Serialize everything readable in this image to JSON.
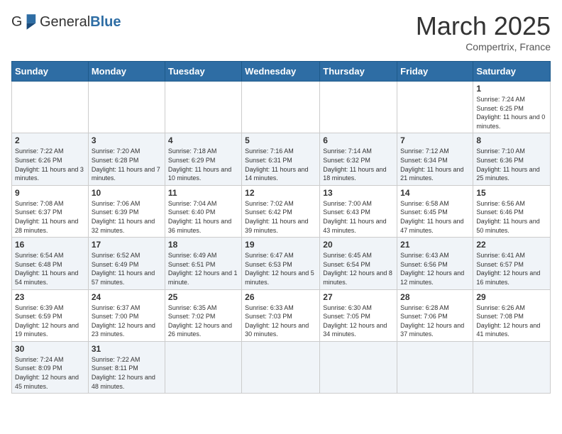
{
  "header": {
    "logo_general": "General",
    "logo_blue": "Blue",
    "month_title": "March 2025",
    "subtitle": "Compertrix, France"
  },
  "days_of_week": [
    "Sunday",
    "Monday",
    "Tuesday",
    "Wednesday",
    "Thursday",
    "Friday",
    "Saturday"
  ],
  "weeks": [
    [
      {
        "day": "",
        "info": ""
      },
      {
        "day": "",
        "info": ""
      },
      {
        "day": "",
        "info": ""
      },
      {
        "day": "",
        "info": ""
      },
      {
        "day": "",
        "info": ""
      },
      {
        "day": "",
        "info": ""
      },
      {
        "day": "1",
        "info": "Sunrise: 7:24 AM\nSunset: 6:25 PM\nDaylight: 11 hours and 0 minutes."
      }
    ],
    [
      {
        "day": "2",
        "info": "Sunrise: 7:22 AM\nSunset: 6:26 PM\nDaylight: 11 hours and 3 minutes."
      },
      {
        "day": "3",
        "info": "Sunrise: 7:20 AM\nSunset: 6:28 PM\nDaylight: 11 hours and 7 minutes."
      },
      {
        "day": "4",
        "info": "Sunrise: 7:18 AM\nSunset: 6:29 PM\nDaylight: 11 hours and 10 minutes."
      },
      {
        "day": "5",
        "info": "Sunrise: 7:16 AM\nSunset: 6:31 PM\nDaylight: 11 hours and 14 minutes."
      },
      {
        "day": "6",
        "info": "Sunrise: 7:14 AM\nSunset: 6:32 PM\nDaylight: 11 hours and 18 minutes."
      },
      {
        "day": "7",
        "info": "Sunrise: 7:12 AM\nSunset: 6:34 PM\nDaylight: 11 hours and 21 minutes."
      },
      {
        "day": "8",
        "info": "Sunrise: 7:10 AM\nSunset: 6:36 PM\nDaylight: 11 hours and 25 minutes."
      }
    ],
    [
      {
        "day": "9",
        "info": "Sunrise: 7:08 AM\nSunset: 6:37 PM\nDaylight: 11 hours and 28 minutes."
      },
      {
        "day": "10",
        "info": "Sunrise: 7:06 AM\nSunset: 6:39 PM\nDaylight: 11 hours and 32 minutes."
      },
      {
        "day": "11",
        "info": "Sunrise: 7:04 AM\nSunset: 6:40 PM\nDaylight: 11 hours and 36 minutes."
      },
      {
        "day": "12",
        "info": "Sunrise: 7:02 AM\nSunset: 6:42 PM\nDaylight: 11 hours and 39 minutes."
      },
      {
        "day": "13",
        "info": "Sunrise: 7:00 AM\nSunset: 6:43 PM\nDaylight: 11 hours and 43 minutes."
      },
      {
        "day": "14",
        "info": "Sunrise: 6:58 AM\nSunset: 6:45 PM\nDaylight: 11 hours and 47 minutes."
      },
      {
        "day": "15",
        "info": "Sunrise: 6:56 AM\nSunset: 6:46 PM\nDaylight: 11 hours and 50 minutes."
      }
    ],
    [
      {
        "day": "16",
        "info": "Sunrise: 6:54 AM\nSunset: 6:48 PM\nDaylight: 11 hours and 54 minutes."
      },
      {
        "day": "17",
        "info": "Sunrise: 6:52 AM\nSunset: 6:49 PM\nDaylight: 11 hours and 57 minutes."
      },
      {
        "day": "18",
        "info": "Sunrise: 6:49 AM\nSunset: 6:51 PM\nDaylight: 12 hours and 1 minute."
      },
      {
        "day": "19",
        "info": "Sunrise: 6:47 AM\nSunset: 6:53 PM\nDaylight: 12 hours and 5 minutes."
      },
      {
        "day": "20",
        "info": "Sunrise: 6:45 AM\nSunset: 6:54 PM\nDaylight: 12 hours and 8 minutes."
      },
      {
        "day": "21",
        "info": "Sunrise: 6:43 AM\nSunset: 6:56 PM\nDaylight: 12 hours and 12 minutes."
      },
      {
        "day": "22",
        "info": "Sunrise: 6:41 AM\nSunset: 6:57 PM\nDaylight: 12 hours and 16 minutes."
      }
    ],
    [
      {
        "day": "23",
        "info": "Sunrise: 6:39 AM\nSunset: 6:59 PM\nDaylight: 12 hours and 19 minutes."
      },
      {
        "day": "24",
        "info": "Sunrise: 6:37 AM\nSunset: 7:00 PM\nDaylight: 12 hours and 23 minutes."
      },
      {
        "day": "25",
        "info": "Sunrise: 6:35 AM\nSunset: 7:02 PM\nDaylight: 12 hours and 26 minutes."
      },
      {
        "day": "26",
        "info": "Sunrise: 6:33 AM\nSunset: 7:03 PM\nDaylight: 12 hours and 30 minutes."
      },
      {
        "day": "27",
        "info": "Sunrise: 6:30 AM\nSunset: 7:05 PM\nDaylight: 12 hours and 34 minutes."
      },
      {
        "day": "28",
        "info": "Sunrise: 6:28 AM\nSunset: 7:06 PM\nDaylight: 12 hours and 37 minutes."
      },
      {
        "day": "29",
        "info": "Sunrise: 6:26 AM\nSunset: 7:08 PM\nDaylight: 12 hours and 41 minutes."
      }
    ],
    [
      {
        "day": "30",
        "info": "Sunrise: 7:24 AM\nSunset: 8:09 PM\nDaylight: 12 hours and 45 minutes."
      },
      {
        "day": "31",
        "info": "Sunrise: 7:22 AM\nSunset: 8:11 PM\nDaylight: 12 hours and 48 minutes."
      },
      {
        "day": "",
        "info": ""
      },
      {
        "day": "",
        "info": ""
      },
      {
        "day": "",
        "info": ""
      },
      {
        "day": "",
        "info": ""
      },
      {
        "day": "",
        "info": ""
      }
    ]
  ]
}
